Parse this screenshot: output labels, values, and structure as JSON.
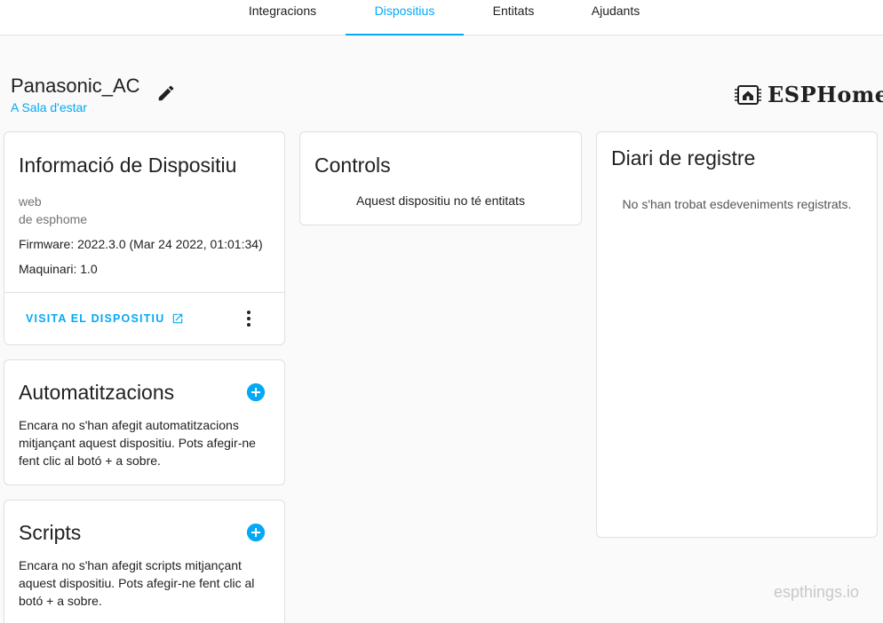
{
  "tabs": [
    {
      "label": "Integracions"
    },
    {
      "label": "Dispositius",
      "active": true
    },
    {
      "label": "Entitats"
    },
    {
      "label": "Ajudants"
    }
  ],
  "device": {
    "name": "Panasonic_AC",
    "area": "A Sala d'estar"
  },
  "brand": {
    "name": "ESPHome",
    "icon": "esphome-chip-house-icon"
  },
  "info_card": {
    "title": "Informació de Dispositiu",
    "model": "web",
    "manufacturer": "de esphome",
    "firmware": "Firmware: 2022.3.0 (Mar 24 2022, 01:01:34)",
    "hardware": "Maquinari: 1.0",
    "visit_label": "VISITA EL DISPOSITIU"
  },
  "controls_card": {
    "title": "Controls",
    "empty": "Aquest dispositiu no té entitats"
  },
  "logbook_card": {
    "title": "Diari de registre",
    "empty": "No s'han trobat esdeveniments registrats."
  },
  "automations_card": {
    "title": "Automatitzacions",
    "text": "Encara no s'han afegit automatitzacions mitjançant aquest dispositiu. Pots afegir-ne fent clic al botó + a sobre."
  },
  "scripts_card": {
    "title": "Scripts",
    "text": "Encara no s'han afegit scripts mitjançant aquest dispositiu. Pots afegir-ne fent clic al botó + a sobre."
  },
  "watermark": "espthings.io",
  "colors": {
    "accent": "#03a9f4",
    "text": "#212121",
    "secondary": "#727272"
  }
}
